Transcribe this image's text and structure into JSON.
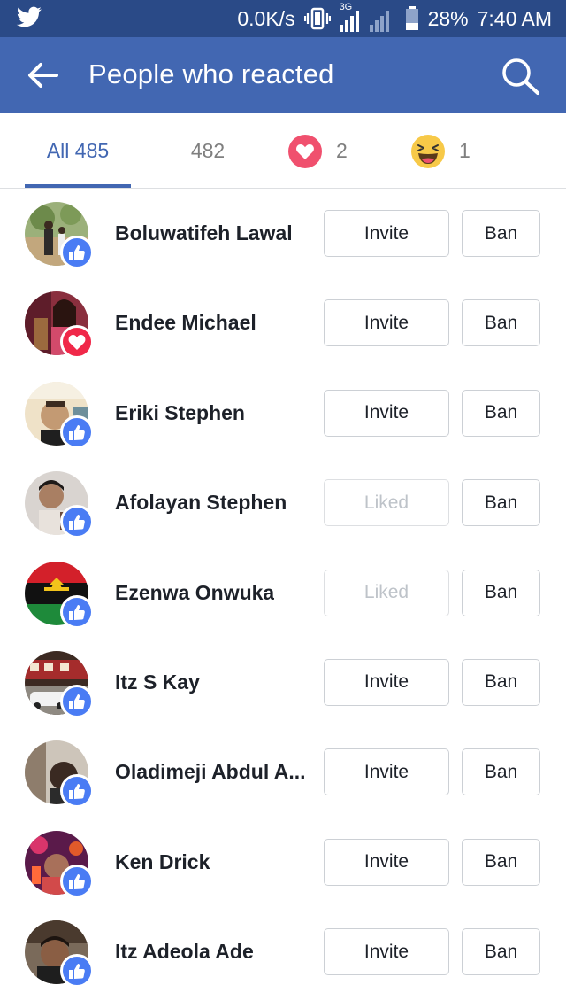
{
  "status_bar": {
    "speed": "0.0K/s",
    "network": "3G",
    "battery": "28%",
    "time": "7:40 AM",
    "bg_color": "#2a4a87"
  },
  "header": {
    "title": "People who reacted",
    "bg_color": "#4267b2"
  },
  "tabs": {
    "all": "All 485",
    "like_count": "482",
    "love_count": "2",
    "haha_count": "1"
  },
  "people": [
    {
      "name": "Boluwatifeh Lawal",
      "reaction": "like",
      "action": "Invite",
      "ban": "Ban"
    },
    {
      "name": "Endee Michael",
      "reaction": "love",
      "action": "Invite",
      "ban": "Ban"
    },
    {
      "name": "Eriki Stephen",
      "reaction": "like",
      "action": "Invite",
      "ban": "Ban"
    },
    {
      "name": "Afolayan Stephen",
      "reaction": "like",
      "action": "Liked",
      "ban": "Ban"
    },
    {
      "name": "Ezenwa Onwuka",
      "reaction": "like",
      "action": "Liked",
      "ban": "Ban"
    },
    {
      "name": "Itz S Kay",
      "reaction": "like",
      "action": "Invite",
      "ban": "Ban"
    },
    {
      "name": "Oladimeji Abdul A...",
      "reaction": "like",
      "action": "Invite",
      "ban": "Ban"
    },
    {
      "name": "Ken Drick",
      "reaction": "like",
      "action": "Invite",
      "ban": "Ban"
    },
    {
      "name": "Itz Adeola Ade",
      "reaction": "like",
      "action": "Invite",
      "ban": "Ban"
    }
  ]
}
